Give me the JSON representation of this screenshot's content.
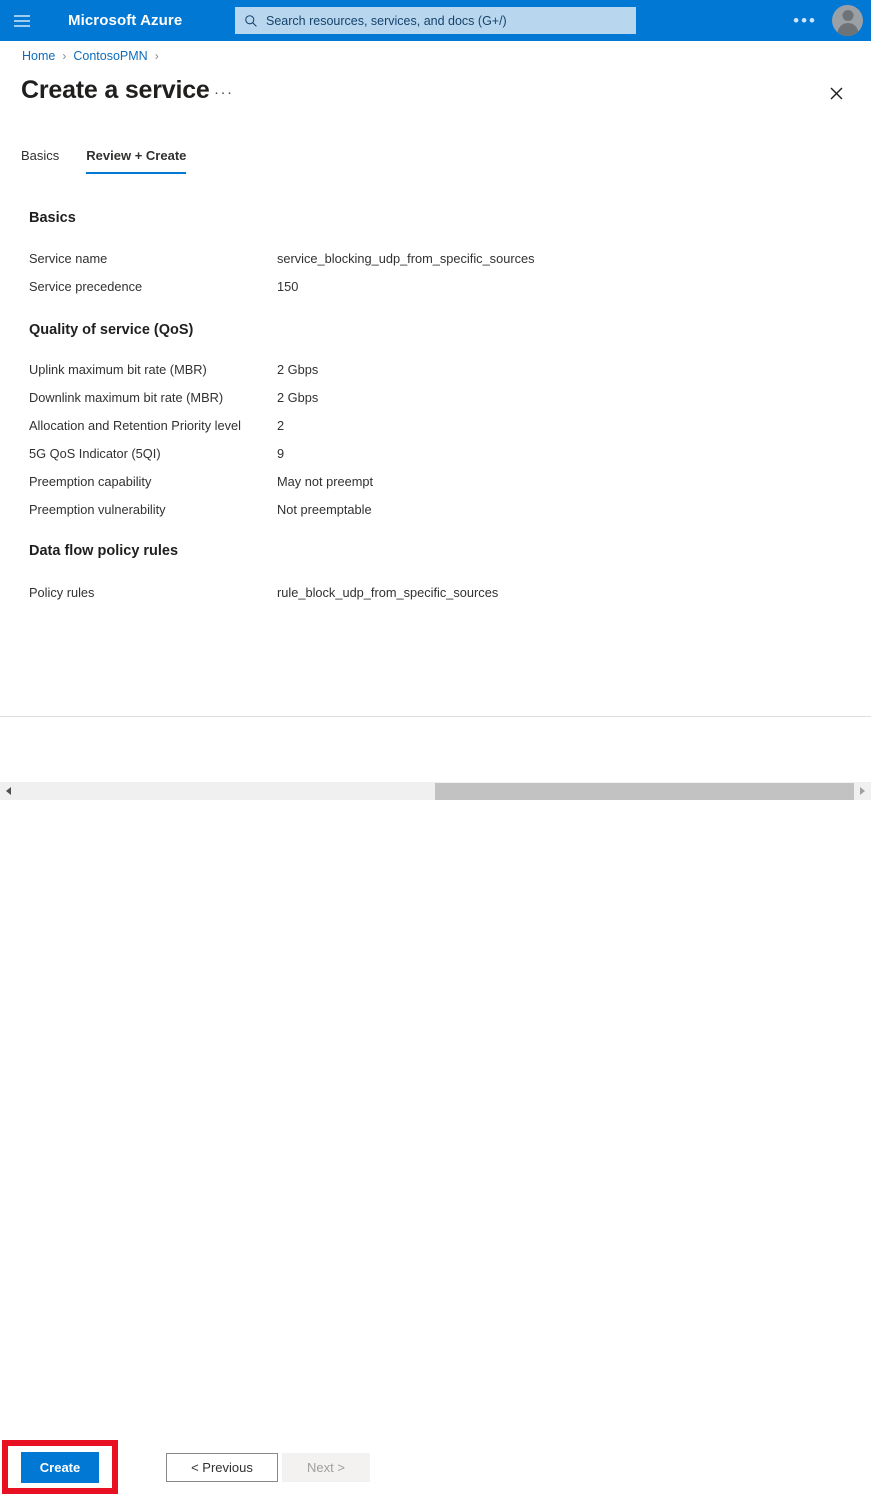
{
  "topbar": {
    "menu_icon": "hamburger-icon",
    "brand": "Microsoft Azure",
    "search": {
      "icon": "search-icon",
      "placeholder": "Search resources, services, and docs (G+/)",
      "value": ""
    },
    "more_label": "•••",
    "account_icon": "user-avatar-icon",
    "background_color": "#0078d4",
    "search_background_color": "#b8d7ef"
  },
  "breadcrumb": {
    "items": [
      {
        "label": "Home"
      },
      {
        "label": "ContosoPMN"
      }
    ],
    "separator": "›"
  },
  "header": {
    "title": "Create a service",
    "more_label": "···",
    "close_icon": "close-icon"
  },
  "tabs": [
    {
      "label": "Basics",
      "active": false
    },
    {
      "label": "Review + Create",
      "active": true
    }
  ],
  "sections": [
    {
      "heading": "Basics",
      "rows": [
        {
          "label": "Service name",
          "value": "service_blocking_udp_from_specific_sources"
        },
        {
          "label": "Service precedence",
          "value": "150"
        }
      ]
    },
    {
      "heading": "Quality of service (QoS)",
      "rows": [
        {
          "label": "Uplink maximum bit rate (MBR)",
          "value": "2 Gbps"
        },
        {
          "label": "Downlink maximum bit rate (MBR)",
          "value": "2 Gbps"
        },
        {
          "label": "Allocation and Retention Priority level",
          "value": "2"
        },
        {
          "label": "5G QoS Indicator (5QI)",
          "value": "9"
        },
        {
          "label": "Preemption capability",
          "value": "May not preempt"
        },
        {
          "label": "Preemption vulnerability",
          "value": "Not preemptable"
        }
      ]
    },
    {
      "heading": "Data flow policy rules",
      "rows": [
        {
          "label": "Policy rules",
          "value": "rule_block_udp_from_specific_sources"
        }
      ]
    }
  ],
  "footer": {
    "create_label": "Create",
    "previous_label": "< Previous",
    "next_label": "Next >",
    "next_disabled": true,
    "highlight_color": "#e81123",
    "primary_color": "#0078d4"
  },
  "scrollbar": {
    "left_arrow_icon": "chevron-left-icon",
    "right_arrow_icon": "chevron-right-icon"
  }
}
